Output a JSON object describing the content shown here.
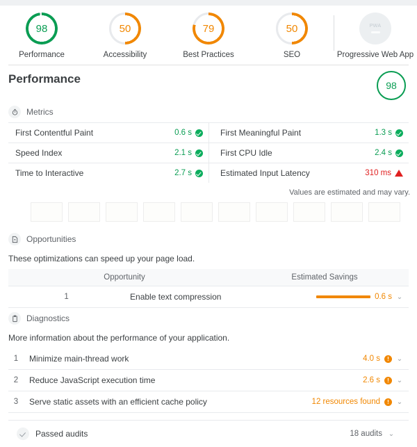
{
  "colors": {
    "pass": "#0a9d53",
    "average": "#f18700",
    "fail": "#e02020",
    "neutral": "#9aa0a6"
  },
  "scores": [
    {
      "value": "98",
      "label": "Performance",
      "pct": 98,
      "state": "pass",
      "icon": "gauge-ring"
    },
    {
      "value": "50",
      "label": "Accessibility",
      "pct": 50,
      "state": "average",
      "icon": "gauge-ring"
    },
    {
      "value": "79",
      "label": "Best Practices",
      "pct": 79,
      "state": "average",
      "icon": "gauge-ring"
    },
    {
      "value": "50",
      "label": "SEO",
      "pct": 50,
      "state": "average",
      "icon": "gauge-ring"
    },
    {
      "value": "PWA",
      "label": "Progressive Web App",
      "state": "none",
      "icon": "pwa-badge"
    }
  ],
  "category": {
    "title": "Performance",
    "score": "98"
  },
  "metrics": {
    "heading": "Metrics",
    "icon": "stopwatch-icon",
    "note": "Values are estimated and may vary.",
    "items": [
      {
        "name": "First Contentful Paint",
        "value": "0.6 s",
        "state": "pass",
        "icon": "check-circle-icon"
      },
      {
        "name": "First Meaningful Paint",
        "value": "1.3 s",
        "state": "pass",
        "icon": "check-circle-icon"
      },
      {
        "name": "Speed Index",
        "value": "2.1 s",
        "state": "pass",
        "icon": "check-circle-icon"
      },
      {
        "name": "First CPU Idle",
        "value": "2.4 s",
        "state": "pass",
        "icon": "check-circle-icon"
      },
      {
        "name": "Time to Interactive",
        "value": "2.7 s",
        "state": "pass",
        "icon": "check-circle-icon"
      },
      {
        "name": "Estimated Input Latency",
        "value": "310 ms",
        "state": "fail",
        "icon": "warning-triangle-icon"
      }
    ]
  },
  "filmstrip": {
    "frame_count": 10
  },
  "opportunities": {
    "heading": "Opportunities",
    "icon": "document-arrow-icon",
    "description": "These optimizations can speed up your page load.",
    "columns": {
      "opportunity": "Opportunity",
      "savings": "Estimated Savings"
    },
    "rows": [
      {
        "index": "1",
        "title": "Enable text compression",
        "value": "0.6 s",
        "bar": true,
        "chevron": "⌄"
      }
    ]
  },
  "diagnostics": {
    "heading": "Diagnostics",
    "icon": "clipboard-icon",
    "description": "More information about the performance of your application.",
    "rows": [
      {
        "index": "1",
        "title": "Minimize main-thread work",
        "value": "4.0 s",
        "icon": "info-circle-icon",
        "chevron": "⌄"
      },
      {
        "index": "2",
        "title": "Reduce JavaScript execution time",
        "value": "2.6 s",
        "icon": "info-circle-icon",
        "chevron": "⌄"
      },
      {
        "index": "3",
        "title": "Serve static assets with an efficient cache policy",
        "value": "12 resources found",
        "icon": "info-circle-icon",
        "chevron": "⌄"
      }
    ]
  },
  "passed_audits": {
    "label": "Passed audits",
    "count": "18 audits",
    "icon": "check-icon",
    "chevron": "⌄"
  }
}
